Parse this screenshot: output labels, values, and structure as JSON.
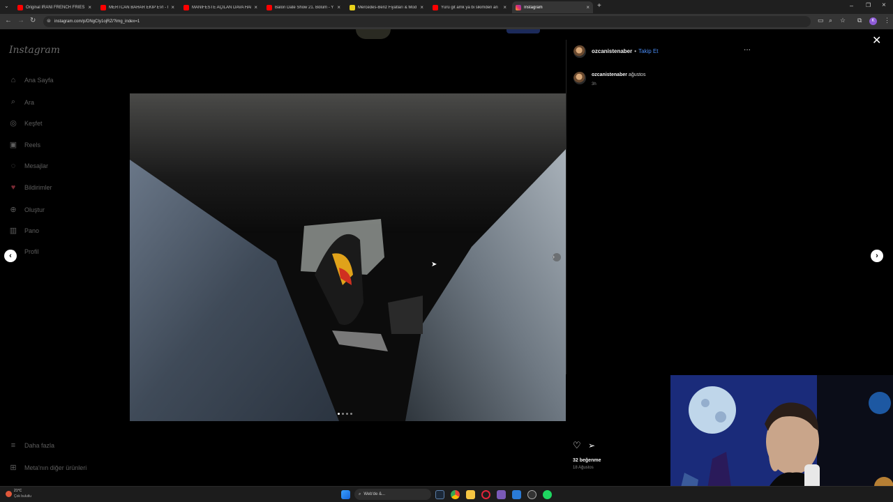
{
  "browser": {
    "tabs": [
      {
        "label": "Original IRANI FRENCH FRIES 🍟",
        "color": "#ff0000"
      },
      {
        "label": "MERTCAN BAHAR EKİP EVİ - M",
        "color": "#ff0000"
      },
      {
        "label": "MANİFESTE AÇILAN DAVA HAK",
        "color": "#ff0000"
      },
      {
        "label": "Balon Date Show 21. Bölüm - Y",
        "color": "#ff0000"
      },
      {
        "label": "Mercedes-Benz Fiyatları & Mod",
        "color": "#e8d21a"
      },
      {
        "label": "Yürü git amk ya bi sikimden an",
        "color": "#ff0000"
      },
      {
        "label": "Instagram",
        "color": "#e1306c"
      }
    ],
    "url": "instagram.com/p/DNgCIy1ojRZ/?img_index=1",
    "profile_initial": "K"
  },
  "instagram": {
    "logo": "Instagram",
    "nav": [
      {
        "label": "Ana Sayfa",
        "icon": "home-icon",
        "glyph": "⌂"
      },
      {
        "label": "Ara",
        "icon": "search-icon",
        "glyph": "⌕"
      },
      {
        "label": "Keşfet",
        "icon": "explore-icon",
        "glyph": "◎"
      },
      {
        "label": "Reels",
        "icon": "reels-icon",
        "glyph": "▣"
      },
      {
        "label": "Mesajlar",
        "icon": "messages-icon",
        "glyph": "◌"
      },
      {
        "label": "Bildirimler",
        "icon": "heart-icon",
        "glyph": "♥"
      },
      {
        "label": "Oluştur",
        "icon": "create-icon",
        "glyph": "⊕"
      },
      {
        "label": "Pano",
        "icon": "dashboard-icon",
        "glyph": "▥"
      },
      {
        "label": "Profil",
        "icon": "profile-icon",
        "glyph": "●"
      }
    ],
    "more_label": "Daha fazla",
    "meta_label": "Meta'nın diğer ürünleri",
    "post": {
      "username": "ozcanistenaber",
      "follow_label": "Takip Et",
      "separator": "•",
      "caption_user": "ozcanistenaber",
      "caption_text": "ağustos",
      "caption_time": "3h",
      "likes": "32 beğenme",
      "date": "18 Ağustos"
    }
  },
  "taskbar": {
    "weather_temp": "21°C",
    "weather_desc": "Çok bulutlu",
    "search_label": "Web'de &..."
  }
}
